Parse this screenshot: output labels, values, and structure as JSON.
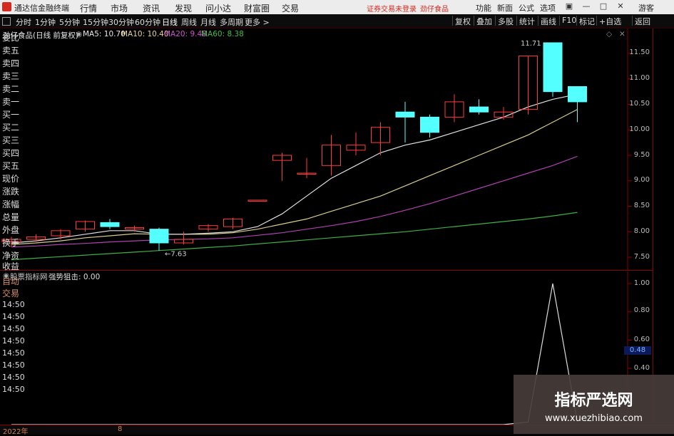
{
  "titlebar": {
    "app_title": "通达信金融终端",
    "menus": [
      "行情",
      "市场",
      "资讯",
      "发现",
      "问小达",
      "财富圈",
      "交易"
    ],
    "notice": "证券交易未登录",
    "stock": "劲仔食品",
    "right_items": [
      "功能",
      "新面",
      "公式",
      "选项"
    ],
    "guest": "游客"
  },
  "toolbar": {
    "periods": [
      "分时",
      "1分钟",
      "5分钟",
      "15分钟",
      "30分钟",
      "60分钟",
      "日线",
      "周线",
      "月线",
      "多周期",
      "更多 >"
    ],
    "active_period": "日线",
    "right_buttons": [
      "复权",
      "叠加",
      "多股",
      "统计",
      "画线",
      "F10",
      "标记",
      "+自选",
      "返回"
    ]
  },
  "main": {
    "stock_label": "劲仔食品(日线 前复权)",
    "ma": [
      {
        "label": "MA5: 10.70",
        "color": "#e8e8e8"
      },
      {
        "label": "MA10: 10.40",
        "color": "#e8d68a"
      },
      {
        "label": "MA20: 9.48",
        "color": "#d050d0"
      },
      {
        "label": "MA60: 8.38",
        "color": "#40c040"
      }
    ],
    "high_label": "11.71",
    "low_label": "7.63",
    "y_ticks": [
      "11.50",
      "11.00",
      "10.50",
      "10.00",
      "9.50",
      "9.00",
      "8.50",
      "8.00",
      "7.50"
    ]
  },
  "right_panel": {
    "labels": [
      "委比",
      "卖五",
      "卖四",
      "卖三",
      "卖二",
      "卖一",
      "买一",
      "买二",
      "买三",
      "买四",
      "买五",
      "现价",
      "涨跌",
      "涨幅",
      "总量",
      "外盘",
      "换手",
      "净资",
      "收益"
    ],
    "sub_labels": [
      "自动",
      "交易",
      "14:50",
      "14:50",
      "14:50",
      "14:50",
      "14:50",
      "14:50",
      "14:50",
      "14:50"
    ]
  },
  "sub": {
    "indicator": "股票指标网",
    "formula": "强势狙击: 0.00",
    "y_ticks": [
      "1.00",
      "0.80",
      "0.60",
      "0.40"
    ],
    "badge": "0.48"
  },
  "bottom": {
    "year": "2022年",
    "month": "8"
  },
  "watermark": {
    "line1": "指标严选网",
    "line2": "www.xuezhibiao.com"
  },
  "chart_data": {
    "type": "candlestick",
    "title": "劲仔食品(日线 前复权)",
    "ylim": [
      7.3,
      11.9
    ],
    "candles": [
      {
        "o": 7.8,
        "c": 7.85,
        "h": 7.9,
        "l": 7.7
      },
      {
        "o": 7.85,
        "c": 7.9,
        "h": 7.95,
        "l": 7.8
      },
      {
        "o": 7.92,
        "c": 8.02,
        "h": 8.05,
        "l": 7.85
      },
      {
        "o": 8.05,
        "c": 8.2,
        "h": 8.22,
        "l": 8.0
      },
      {
        "o": 8.18,
        "c": 8.1,
        "h": 8.25,
        "l": 8.05
      },
      {
        "o": 8.05,
        "c": 8.08,
        "h": 8.12,
        "l": 8.0
      },
      {
        "o": 8.05,
        "c": 7.78,
        "h": 8.08,
        "l": 7.63
      },
      {
        "o": 7.78,
        "c": 7.85,
        "h": 8.0,
        "l": 7.75
      },
      {
        "o": 8.05,
        "c": 8.12,
        "h": 8.15,
        "l": 8.0
      },
      {
        "o": 8.1,
        "c": 8.25,
        "h": 8.27,
        "l": 8.05
      },
      {
        "o": 8.62,
        "c": 8.62,
        "h": 8.62,
        "l": 8.62
      },
      {
        "o": 9.4,
        "c": 9.5,
        "h": 9.55,
        "l": 9.0
      },
      {
        "o": 9.15,
        "c": 9.15,
        "h": 9.45,
        "l": 9.05
      },
      {
        "o": 9.3,
        "c": 9.7,
        "h": 9.9,
        "l": 9.1
      },
      {
        "o": 9.6,
        "c": 9.7,
        "h": 9.95,
        "l": 9.5
      },
      {
        "o": 9.75,
        "c": 10.05,
        "h": 10.15,
        "l": 9.5
      },
      {
        "o": 10.35,
        "c": 10.25,
        "h": 10.55,
        "l": 9.75
      },
      {
        "o": 10.25,
        "c": 9.95,
        "h": 10.3,
        "l": 9.85
      },
      {
        "o": 10.25,
        "c": 10.55,
        "h": 10.7,
        "l": 10.15
      },
      {
        "o": 10.45,
        "c": 10.35,
        "h": 10.6,
        "l": 10.3
      },
      {
        "o": 10.25,
        "c": 10.35,
        "h": 10.45,
        "l": 10.2
      },
      {
        "o": 10.4,
        "c": 11.45,
        "h": 11.45,
        "l": 10.3
      },
      {
        "o": 11.71,
        "c": 10.75,
        "h": 11.71,
        "l": 10.65
      },
      {
        "o": 10.85,
        "c": 10.55,
        "h": 10.85,
        "l": 10.15
      }
    ],
    "ma5": [
      7.78,
      7.82,
      7.88,
      7.95,
      8.02,
      8.02,
      7.95,
      7.95,
      7.97,
      8.0,
      8.1,
      8.35,
      8.7,
      9.05,
      9.3,
      9.55,
      9.7,
      9.8,
      9.95,
      10.1,
      10.25,
      10.45,
      10.6,
      10.7
    ],
    "ma10": [
      7.75,
      7.78,
      7.82,
      7.88,
      7.92,
      7.96,
      7.95,
      7.95,
      7.95,
      7.98,
      8.05,
      8.15,
      8.25,
      8.4,
      8.55,
      8.7,
      8.9,
      9.1,
      9.3,
      9.5,
      9.7,
      9.9,
      10.15,
      10.4
    ],
    "ma20": [
      7.7,
      7.72,
      7.75,
      7.77,
      7.8,
      7.82,
      7.84,
      7.85,
      7.86,
      7.88,
      7.93,
      7.98,
      8.05,
      8.12,
      8.2,
      8.3,
      8.42,
      8.55,
      8.7,
      8.85,
      9.0,
      9.15,
      9.3,
      9.48
    ],
    "ma60": [
      7.45,
      7.48,
      7.51,
      7.54,
      7.57,
      7.6,
      7.63,
      7.66,
      7.69,
      7.72,
      7.76,
      7.8,
      7.84,
      7.88,
      7.92,
      7.96,
      8.0,
      8.05,
      8.1,
      8.15,
      8.2,
      8.25,
      8.31,
      8.38
    ],
    "sub_series": [
      0,
      0,
      0,
      0,
      0,
      0,
      0,
      0,
      0,
      0,
      0,
      0,
      0,
      0,
      0,
      0,
      0,
      0,
      0,
      0,
      0,
      0.02,
      1.0,
      0.02
    ]
  }
}
